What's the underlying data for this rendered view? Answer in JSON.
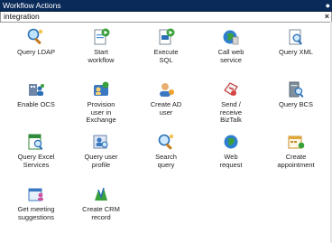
{
  "window": {
    "title": "Workflow Actions",
    "pin_icon": "pin-icon"
  },
  "search": {
    "value": "integration",
    "clear_icon": "close-icon"
  },
  "actions": [
    {
      "label": "Query LDAP",
      "icon": "magnifier-person-icon"
    },
    {
      "label": "Start\nworkflow",
      "icon": "document-play-icon"
    },
    {
      "label": "Execute\nSQL",
      "icon": "document-sql-icon"
    },
    {
      "label": "Call web\nservice",
      "icon": "globe-icon"
    },
    {
      "label": "Query XML",
      "icon": "document-magnifier-icon"
    },
    {
      "label": "Enable OCS",
      "icon": "building-people-icon"
    },
    {
      "label": "Provision\nuser in\nExchange",
      "icon": "exchange-user-icon"
    },
    {
      "label": "Create AD\nuser",
      "icon": "user-add-icon"
    },
    {
      "label": "Send /\nreceive\nBizTalk",
      "icon": "biztalk-icon"
    },
    {
      "label": "Query BCS",
      "icon": "server-magnifier-icon"
    },
    {
      "label": "Query Excel\nServices",
      "icon": "excel-magnifier-icon"
    },
    {
      "label": "Query user\nprofile",
      "icon": "profile-magnifier-icon"
    },
    {
      "label": "Search\nquery",
      "icon": "search-person-icon"
    },
    {
      "label": "Web\nrequest",
      "icon": "globe-request-icon"
    },
    {
      "label": "Create\nappointment",
      "icon": "calendar-add-icon"
    },
    {
      "label": "Get meeting\nsuggestions",
      "icon": "calendar-people-icon"
    },
    {
      "label": "Create CRM\nrecord",
      "icon": "crm-icon"
    }
  ]
}
